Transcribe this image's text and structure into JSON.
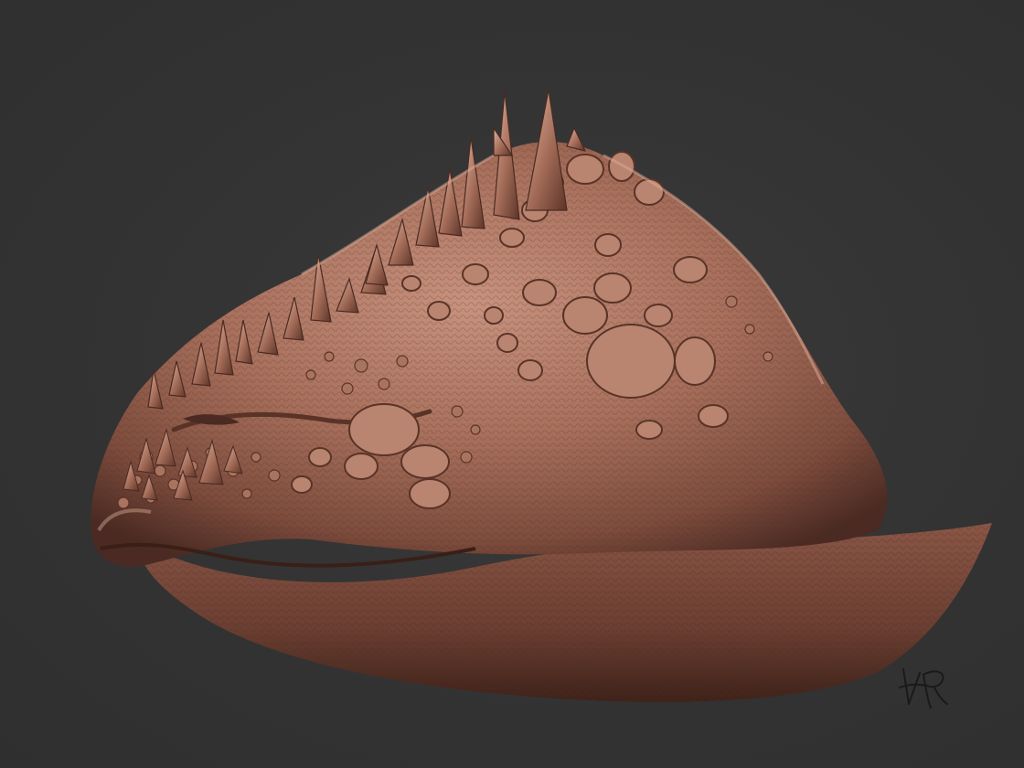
{
  "scene": {
    "background_color": "#333333",
    "subject": "sculpted-creature-head",
    "material_color": "#a8705c",
    "shadow_color": "#4a2a22",
    "highlight_color": "#d8a894"
  },
  "signature": {
    "kind": "handwritten-signature",
    "ink_color": "#1a1a1a"
  }
}
